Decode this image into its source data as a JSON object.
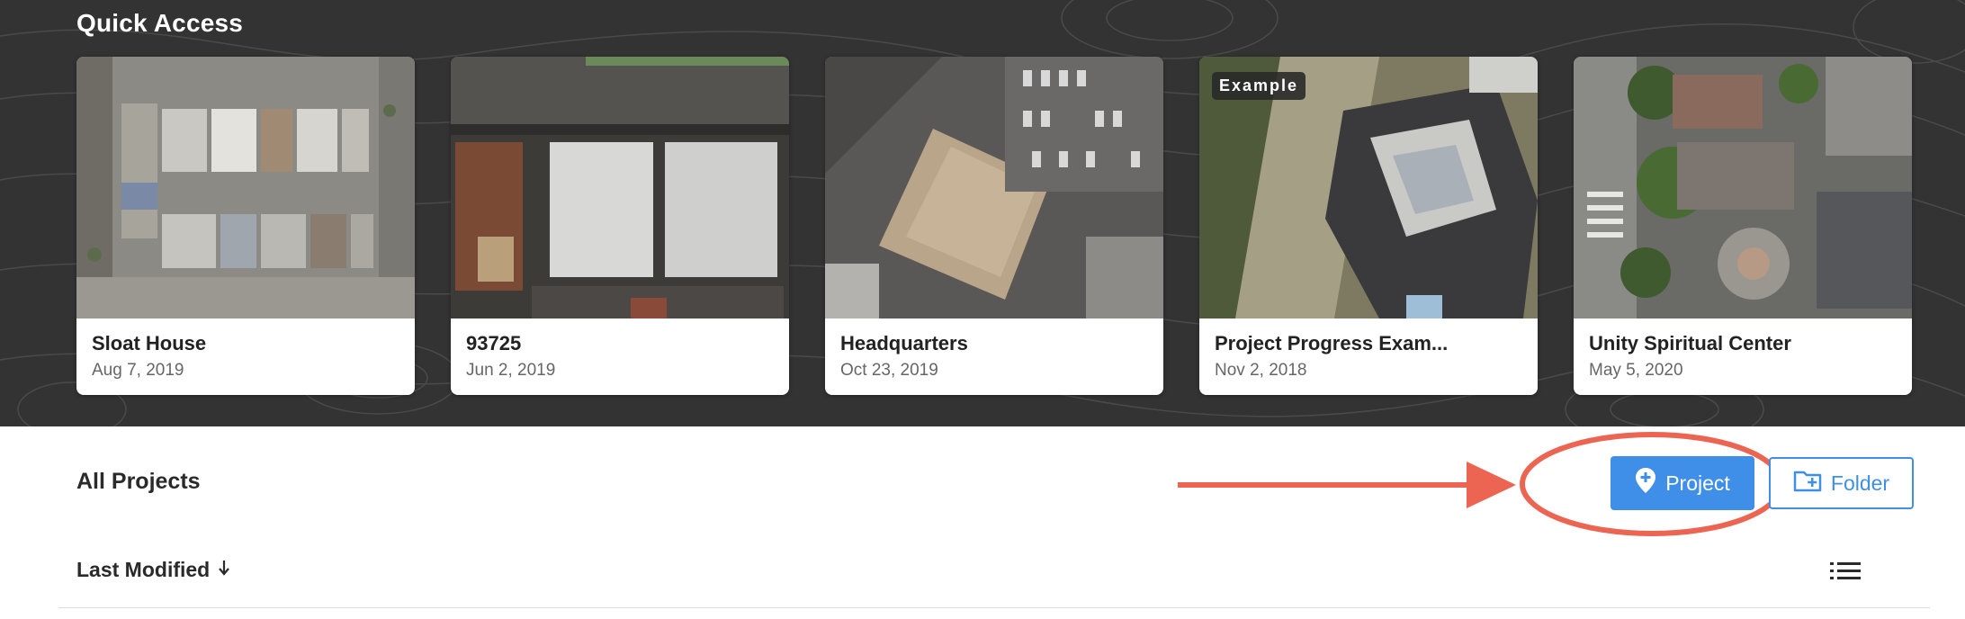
{
  "quick_access": {
    "title": "Quick Access",
    "projects": [
      {
        "name": "Sloat House",
        "date": "Aug 7, 2019",
        "badge": ""
      },
      {
        "name": "93725",
        "date": "Jun 2, 2019",
        "badge": ""
      },
      {
        "name": "Headquarters",
        "date": "Oct 23, 2019",
        "badge": ""
      },
      {
        "name": "Project Progress Exam...",
        "date": "Nov 2, 2018",
        "badge": "Example"
      },
      {
        "name": "Unity Spiritual Center",
        "date": "May 5, 2020",
        "badge": ""
      }
    ]
  },
  "all_projects": {
    "title": "All Projects",
    "new_project_label": "Project",
    "new_folder_label": "Folder",
    "project_icon": "map-pin-plus-icon",
    "folder_icon": "folder-plus-icon",
    "sort_label": "Last Modified",
    "sort_icon": "arrow-down-icon",
    "view_icon": "list-view-icon"
  },
  "annotation": {
    "color": "#ec6553"
  },
  "colors": {
    "hero_background": "#333333",
    "accent": "#3f8fe8",
    "annotation": "#ec6553"
  }
}
